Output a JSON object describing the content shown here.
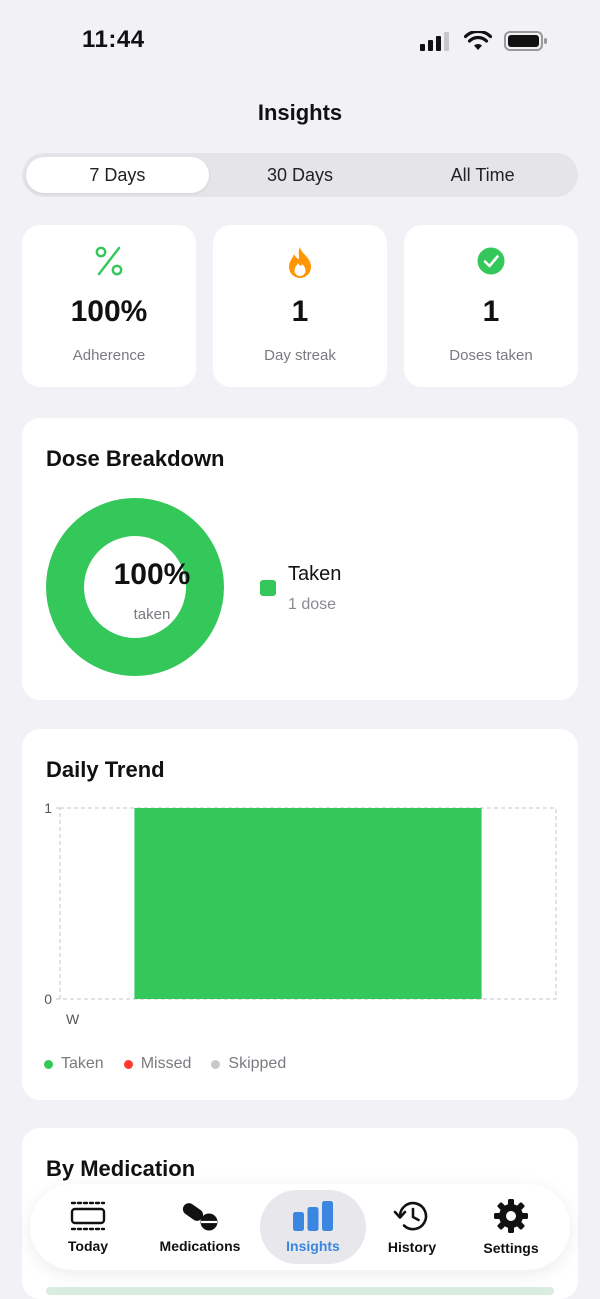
{
  "status": {
    "time": "11:44"
  },
  "title": "Insights",
  "segments": [
    {
      "label": "7 Days",
      "active": true
    },
    {
      "label": "30 Days",
      "active": false
    },
    {
      "label": "All Time",
      "active": false
    }
  ],
  "stats": [
    {
      "icon": "percent-icon",
      "value": "100%",
      "label": "Adherence"
    },
    {
      "icon": "flame-icon",
      "value": "1",
      "label": "Day streak"
    },
    {
      "icon": "checkmark-circle-icon",
      "value": "1",
      "label": "Doses taken"
    }
  ],
  "dose_breakdown": {
    "title": "Dose Breakdown",
    "center_value": "100%",
    "center_label": "taken",
    "taken_fraction": 1.0,
    "legend": [
      {
        "name": "Taken",
        "sub": "1 dose",
        "color": "#34c759"
      }
    ]
  },
  "daily_trend": {
    "title": "Daily Trend",
    "legend": [
      {
        "name": "Taken",
        "color": "#34c759"
      },
      {
        "name": "Missed",
        "color": "#ff3b30"
      },
      {
        "name": "Skipped",
        "color": "#c7c7cc"
      }
    ]
  },
  "chart_data": {
    "type": "bar",
    "categories": [
      "W"
    ],
    "series": [
      {
        "name": "Taken",
        "values": [
          1
        ]
      }
    ],
    "yticks": [
      "0",
      "1"
    ],
    "ylim": [
      0,
      1
    ],
    "grid": "dashed"
  },
  "by_medication": {
    "title": "By Medication"
  },
  "tabs": [
    {
      "label": "Today",
      "icon": "list-icon",
      "active": false
    },
    {
      "label": "Medications",
      "icon": "pills-icon",
      "active": false
    },
    {
      "label": "Insights",
      "icon": "bar-chart-icon",
      "active": true
    },
    {
      "label": "History",
      "icon": "history-icon",
      "active": false
    },
    {
      "label": "Settings",
      "icon": "gear-icon",
      "active": false
    }
  ],
  "colors": {
    "accent": "#3a86e0",
    "taken": "#34c759",
    "missed": "#ff3b30",
    "skipped": "#c7c7cc",
    "streak": "#ff9500"
  }
}
